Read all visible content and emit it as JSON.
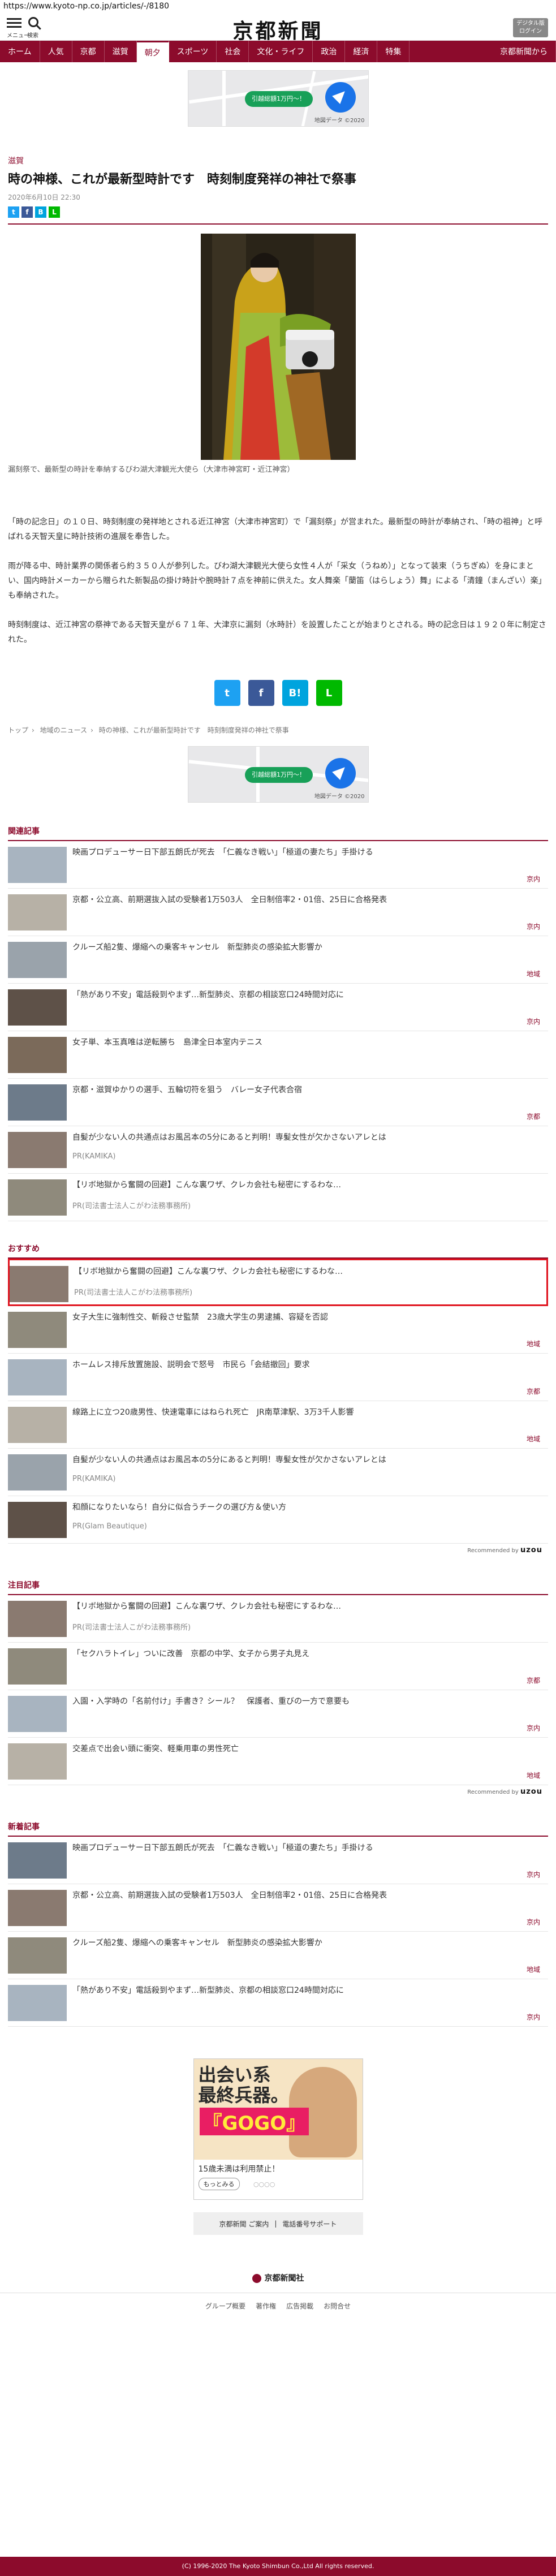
{
  "url": "https://www.kyoto-np.co.jp/articles/-/8180",
  "header": {
    "menu_label": "メニュー",
    "search_label": "検索",
    "logo": "京都新聞",
    "digital_button": "デジタル版 ログイン"
  },
  "nav": [
    "ホーム",
    "人気",
    "京都",
    "滋賀",
    "朝夕",
    "スポーツ",
    "社会",
    "文化・ライフ",
    "政治",
    "経済",
    "特集",
    "京都新聞から"
  ],
  "nav_active": "朝夕",
  "ad_map": {
    "pill": "引越総額1万円〜！",
    "credit": "地図データ ©2020"
  },
  "article": {
    "category": "滋賀",
    "title": "時の神様、これが最新型時計です　時刻制度発祥の神社で祭事",
    "date": "2020年6月10日 22:30",
    "caption": "漏刻祭で、最新型の時計を奉納するびわ湖大津観光大使ら（大津市神宮町・近江神宮）",
    "paragraphs": [
      "「時の記念日」の１０日、時刻制度の発祥地とされる近江神宮（大津市神宮町）で「漏刻祭」が営まれた。最新型の時計が奉納され、「時の祖神」と呼ばれる天智天皇に時計技術の進展を奉告した。",
      "雨が降る中、時計業界の関係者ら約３５０人が参列した。びわ湖大津観光大使ら女性４人が「采女（うねめ）」となって装束（うちぎぬ）を身にまとい、国内時計メーカーから贈られた新製品の掛け時計や腕時計７点を神前に供えた。女人舞楽「蘭笛（はらしょう）舞」による「清鐘（まんざい）楽」も奉納された。",
      "時刻制度は、近江神宮の祭神である天智天皇が６７１年、大津京に漏刻（水時計）を設置したことが始まりとされる。時の記念日は１９２０年に制定された。"
    ]
  },
  "breadcrumb": [
    "トップ",
    "地域のニュース",
    "時の神様、これが最新型時計です　時刻制度発祥の神社で祭事"
  ],
  "related": {
    "heading": "関連記事",
    "items": [
      {
        "title": "映画プロデューサー日下部五朗氏が死去　「仁義なき戦い」「極道の妻たち」手掛ける",
        "tag": "京内"
      },
      {
        "title": "京都・公立高、前期選抜入試の受験者1万503人　全日制倍率2・01倍、25日に合格発表",
        "tag": "京内"
      },
      {
        "title": "クルーズ船2隻、爆縮への乗客キャンセル　新型肺炎の感染拡大影響か",
        "tag": "地域"
      },
      {
        "title": "「熱があり不安」電話殺到やまず…新型肺炎、京都の相談窓口24時間対応に",
        "tag": "京内"
      },
      {
        "title": "女子単、本玉真唯は逆転勝ち　島津全日本室内テニス",
        "tag": ""
      },
      {
        "title": "京都・滋賀ゆかりの選手、五輪切符を狙う　バレー女子代表合宿",
        "tag": "京都"
      },
      {
        "title": "自髪が少ない人の共通点はお風呂本の5分にあると判明！専髪女性が欠かさないアレとは",
        "tag": "",
        "pr": "PR(KAMIKA)"
      },
      {
        "title": "【リボ地獄から奮闘の回避】こんな裏ワザ、クレカ会社も秘密にするわな…",
        "tag": "",
        "pr": "PR(司法書士法人こがわ法務事務所)"
      }
    ]
  },
  "recommend": {
    "heading": "おすすめ",
    "items": [
      {
        "title": "【リボ地獄から奮闘の回避】こんな裏ワザ、クレカ会社も秘密にするわな…",
        "tag": "",
        "pr": "PR(司法書士法人こがわ法務事務所)"
      },
      {
        "title": "女子大生に強制性交、斬殺させ監禁　23歳大学生の男逮捕、容疑を否認",
        "tag": "地域"
      },
      {
        "title": "ホームレス排斥放置施設、説明会で怒号　市民ら「会結撤回」要求",
        "tag": "京都"
      },
      {
        "title": "線路上に立つ20歳男性、快速電車にはねられ死亡　JR南草津駅、3万3千人影響",
        "tag": "地域"
      },
      {
        "title": "自髪が少ない人の共通点はお風呂本の5分にあると判明！専髪女性が欠かさないアレとは",
        "tag": "",
        "pr": "PR(KAMIKA)"
      },
      {
        "title": "和顔になりたいなら！自分に似合うチークの選び方＆使い方",
        "tag": "",
        "pr": "PR(Glam Beautique)"
      }
    ],
    "powered": "Recommended by",
    "brand": "uzou"
  },
  "attention": {
    "heading": "注目記事",
    "items": [
      {
        "title": "【リボ地獄から奮闘の回避】こんな裏ワザ、クレカ会社も秘密にするわな…",
        "tag": "",
        "pr": "PR(司法書士法人こがわ法務事務所)"
      },
      {
        "title": "「セクハラトイレ」ついに改善　京都の中学、女子から男子丸見え",
        "tag": "京都"
      },
      {
        "title": "入園・入学時の「名前付け」手書き？シール？　保護者、重びの一方で意要も",
        "tag": "京内"
      },
      {
        "title": "交差点で出会い頭に衝突、軽乗用車の男性死亡",
        "tag": "地域"
      }
    ],
    "powered": "Recommended by",
    "brand": "uzou"
  },
  "latest": {
    "heading": "新着記事",
    "items": [
      {
        "title": "映画プロデューサー日下部五朗氏が死去　「仁義なき戦い」「極道の妻たち」手掛ける",
        "tag": "京内"
      },
      {
        "title": "京都・公立高、前期選抜入試の受験者1万503人　全日制倍率2・01倍、25日に合格発表",
        "tag": "京内"
      },
      {
        "title": "クルーズ船2隻、爆縮への乗客キャンセル　新型肺炎の感染拡大影響か",
        "tag": "地域"
      },
      {
        "title": "「熱があり不安」電話殺到やまず…新型肺炎、京都の相談窓口24時間対応に",
        "tag": "京内"
      }
    ]
  },
  "big_ad": {
    "line1": "出会い系",
    "line2": "最終兵器。",
    "brand": "『GOGO』",
    "text": "15歳未満は利用禁止！",
    "more": "もっとみる",
    "dots": "○○○○"
  },
  "footer": {
    "links": [
      "京都新聞 ご案内",
      "電話番号サポート"
    ],
    "logo": "京都新聞社",
    "nav": [
      "グループ概要",
      "著作権",
      "広告掲載",
      "お問合せ"
    ],
    "copyright": "(C) 1996-2020 The Kyoto Shimbun Co.,Ltd All rights reserved."
  }
}
